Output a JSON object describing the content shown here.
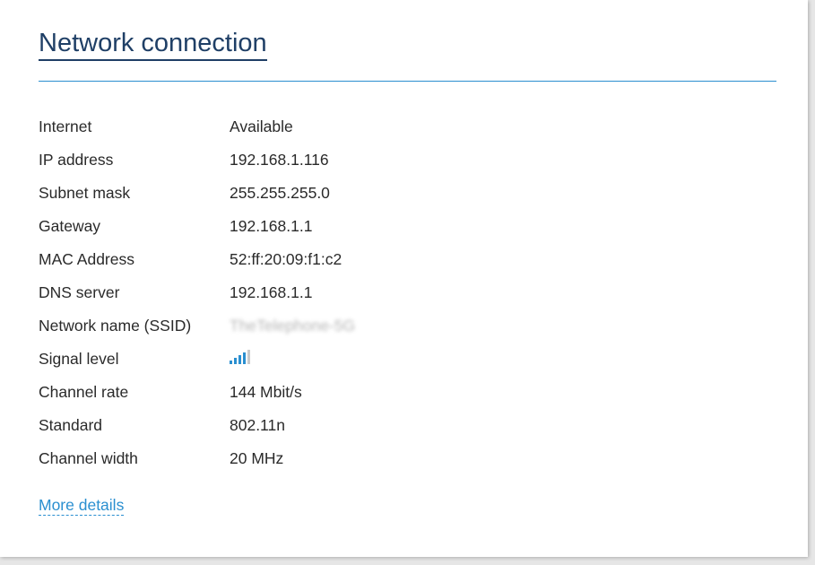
{
  "card": {
    "title": "Network connection",
    "more_details_label": "More details"
  },
  "rows": [
    {
      "label": "Internet",
      "value": "Available"
    },
    {
      "label": "IP address",
      "value": "192.168.1.116"
    },
    {
      "label": "Subnet mask",
      "value": "255.255.255.0"
    },
    {
      "label": "Gateway",
      "value": "192.168.1.1"
    },
    {
      "label": "MAC Address",
      "value": "52:ff:20:09:f1:c2"
    },
    {
      "label": "DNS server",
      "value": "192.168.1.1"
    },
    {
      "label": "Network name (SSID)",
      "value": "TheTelephone-5G"
    },
    {
      "label": "Signal level",
      "icon": "signal-strength-icon",
      "signal_bars_active": 4,
      "signal_bars_total": 5
    },
    {
      "label": "Channel rate",
      "value": "144 Mbit/s"
    },
    {
      "label": "Standard",
      "value": "802.11n"
    },
    {
      "label": "Channel width",
      "value": "20 MHz"
    }
  ],
  "colors": {
    "title": "#1f3f66",
    "accent": "#2a8fd0",
    "text": "#2a2a2a"
  }
}
